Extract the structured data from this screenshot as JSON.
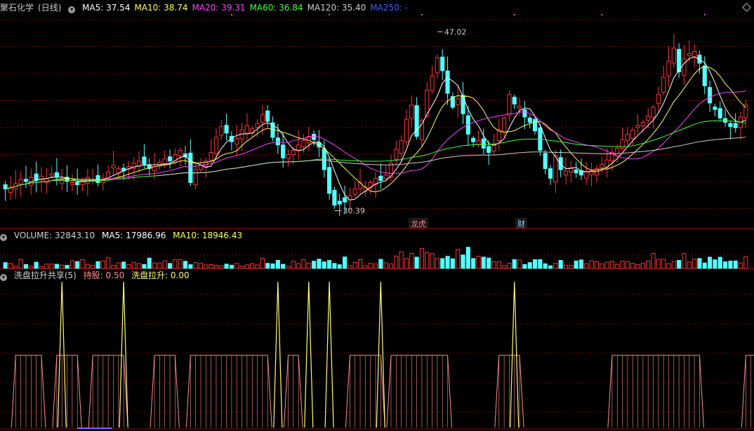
{
  "header": {
    "stock_name": "聚石化学",
    "period": "(日线)",
    "ma": [
      {
        "label": "MA5: 37.54",
        "color": "#ffffff"
      },
      {
        "label": "MA10: 38.74",
        "color": "#ffff55"
      },
      {
        "label": "MA20: 39.31",
        "color": "#ff44ff"
      },
      {
        "label": "MA60: 36.84",
        "color": "#44ff44"
      },
      {
        "label": "MA120: 35.40",
        "color": "#cfcfcf"
      },
      {
        "label": "MA250: -",
        "color": "#3f5fff"
      }
    ]
  },
  "price_annotations": {
    "high_label": "47.02",
    "low_label": "30.39",
    "event_1": "龙虎",
    "event_2": "财"
  },
  "volume_header": {
    "title": "VOLUME: 32843.10",
    "ma5": "MA5: 17986.96",
    "ma10": "MA10: 18946.43"
  },
  "indicator_header": {
    "title": "洗盘拉升共享(5)",
    "hold": "持股: 0.50",
    "wash": "洗盘拉升: 0.00"
  },
  "colors": {
    "up": "#ff3333",
    "down": "#54ffff",
    "grid": "#800000",
    "divider": "#b00000",
    "ma5": "#ffffff",
    "ma10": "#ffff55",
    "ma20": "#ff44ff",
    "ma60": "#44ff44",
    "ma120": "#cfcfcf",
    "hold_line": "#ff9090",
    "wash_line": "#ffff70"
  },
  "chart_data": {
    "type": "candlestick",
    "price_range": [
      28.8,
      48.8
    ],
    "high": 47.02,
    "low": 30.39,
    "candles_close": [
      32.4,
      32.6,
      32.9,
      33.3,
      33.1,
      33.5,
      33.2,
      33.6,
      33.4,
      33.8,
      33.5,
      33.3,
      33.1,
      33.0,
      32.8,
      33.2,
      33.5,
      33.3,
      33.0,
      33.4,
      34.0,
      34.6,
      34.3,
      34.1,
      34.5,
      34.8,
      35.0,
      34.7,
      34.3,
      34.5,
      34.9,
      35.2,
      35.0,
      35.6,
      36.0,
      35.4,
      33.0,
      34.2,
      34.6,
      35.0,
      35.8,
      37.2,
      38.2,
      37.6,
      36.8,
      37.1,
      37.9,
      38.3,
      38.0,
      38.5,
      39.3,
      38.7,
      37.2,
      36.5,
      35.3,
      35.6,
      36.0,
      36.5,
      36.9,
      37.3,
      37.0,
      36.3,
      34.2,
      32.0,
      30.9,
      31.0,
      31.2,
      31.8,
      32.4,
      33.0,
      32.6,
      33.0,
      33.4,
      33.2,
      33.7,
      34.8,
      36.1,
      36.9,
      38.9,
      40.2,
      37.3,
      38.8,
      41.6,
      42.9,
      44.6,
      43.4,
      41.3,
      40.0,
      40.8,
      39.4,
      37.5,
      36.8,
      36.9,
      36.2,
      35.8,
      36.6,
      37.9,
      39.0,
      41.2,
      40.3,
      40.1,
      39.1,
      38.6,
      37.8,
      36.0,
      34.3,
      33.4,
      35.5,
      34.2,
      34.1,
      34.4,
      33.9,
      33.7,
      34.0,
      34.1,
      34.3,
      34.7,
      35.1,
      35.8,
      36.2,
      37.0,
      37.5,
      37.9,
      38.3,
      38.6,
      39.2,
      40.0,
      41.2,
      42.8,
      44.3,
      45.5,
      43.3,
      44.5,
      45.0,
      45.2,
      44.1,
      42.0,
      40.4,
      39.8,
      39.0,
      38.6,
      38.2,
      38.1,
      39.1,
      40.2
    ]
  }
}
